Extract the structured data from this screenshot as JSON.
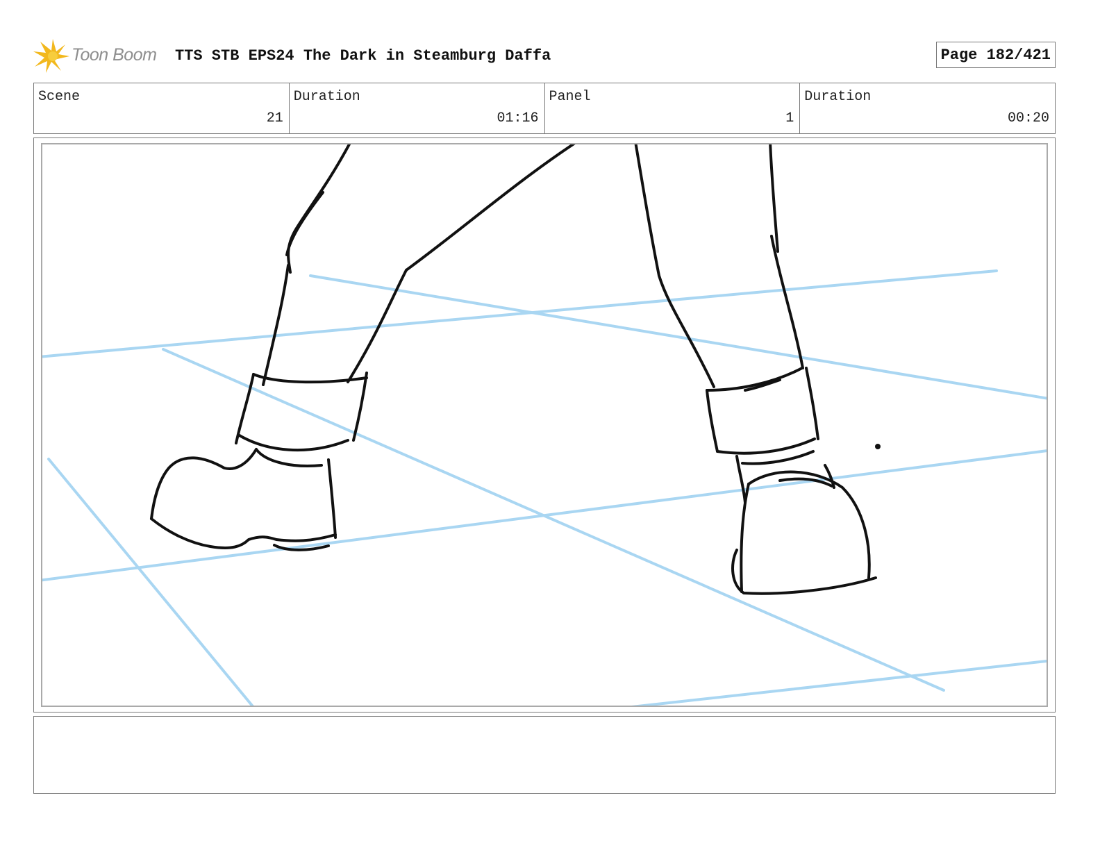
{
  "header": {
    "logo_text": "Toon Boom",
    "doc_title": "TTS STB EPS24 The Dark in Steamburg Daffa",
    "page_label": "Page 182/421"
  },
  "info": {
    "scene_label": "Scene",
    "scene_value": "21",
    "scene_duration_label": "Duration",
    "scene_duration_value": "01:16",
    "panel_label": "Panel",
    "panel_value": "1",
    "panel_duration_label": "Duration",
    "panel_duration_value": "00:20"
  },
  "colors": {
    "sketch_line": "#111111",
    "guide_line": "#a9d6f2",
    "logo_burst": "#f2b81d"
  },
  "notes": {
    "text": ""
  }
}
